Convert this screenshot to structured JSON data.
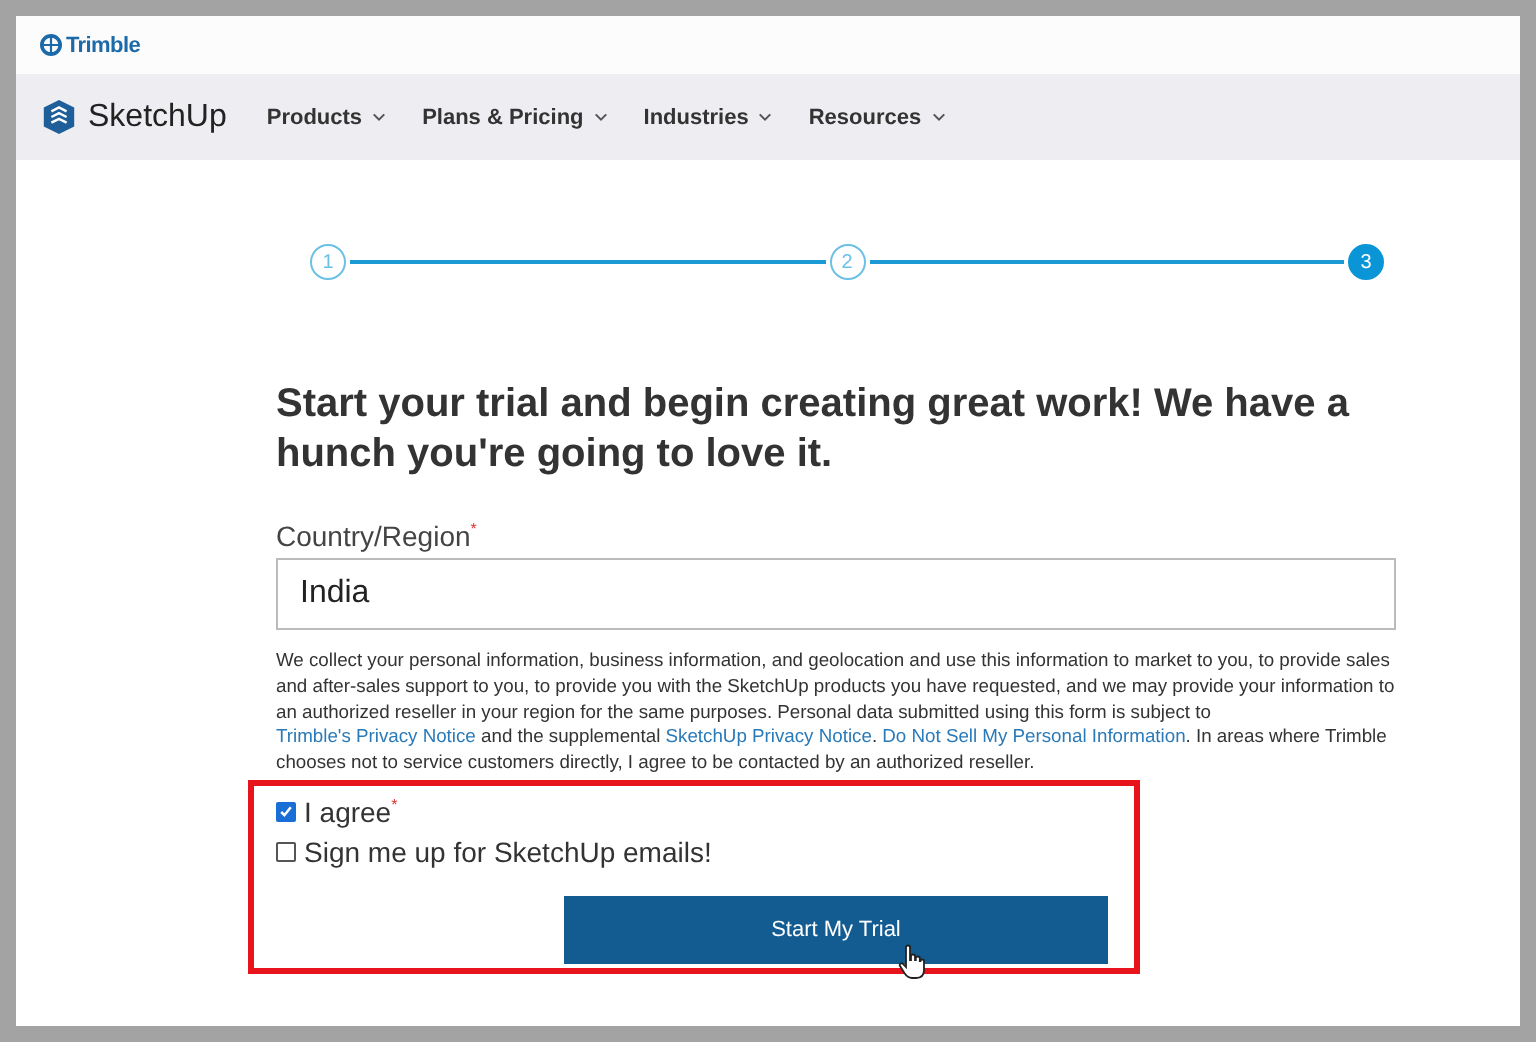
{
  "top_bar": {
    "brand": "Trimble"
  },
  "nav": {
    "logo": "SketchUp",
    "items": [
      {
        "label": "Products"
      },
      {
        "label": "Plans & Pricing"
      },
      {
        "label": "Industries"
      },
      {
        "label": "Resources"
      }
    ]
  },
  "steps": [
    {
      "label": "1",
      "selected": false
    },
    {
      "label": "2",
      "selected": false
    },
    {
      "label": "3",
      "selected": true
    }
  ],
  "heading": "Start your trial and begin creating great work! We have a hunch you're going to love it.",
  "country_field": {
    "label": "Country/Region",
    "required_mark": "*",
    "value": "India"
  },
  "notice": [
    {
      "kind": "text",
      "text": "We collect your personal information, business information, and geolocation and use this information to market to you, to provide sales and after-sales support to you, to provide you with the SketchUp products you have requested, and we may provide your information to an authorized reseller in your region for the same purposes. Personal data submitted using this form is subject to "
    },
    {
      "kind": "link",
      "text": "Trimble's Privacy Notice"
    },
    {
      "kind": "text",
      "text": " and the supplemental "
    },
    {
      "kind": "link",
      "text": "SketchUp Privacy Notice"
    },
    {
      "kind": "text",
      "text": ". "
    },
    {
      "kind": "link",
      "text": "Do Not Sell My Personal Information"
    },
    {
      "kind": "text",
      "text": ". In areas where Trimble chooses not to service customers directly, I agree to be contacted by an authorized reseller."
    }
  ],
  "checkboxes": [
    {
      "label": "I agree",
      "required_mark": "*",
      "checked": true
    },
    {
      "label": "Sign me up for SketchUp emails!",
      "checked": false
    }
  ],
  "submit_button": "Start My Trial"
}
